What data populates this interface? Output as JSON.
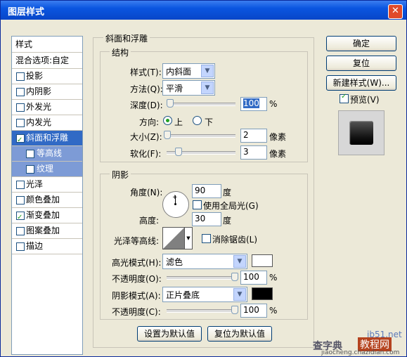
{
  "window": {
    "title": "图层样式",
    "close": "✕"
  },
  "sidebar": {
    "header": "样式",
    "blend": "混合选项:自定",
    "items": [
      {
        "label": "投影",
        "checked": false
      },
      {
        "label": "内阴影",
        "checked": false
      },
      {
        "label": "外发光",
        "checked": false
      },
      {
        "label": "内发光",
        "checked": false
      },
      {
        "label": "斜面和浮雕",
        "checked": true
      },
      {
        "label": "等高线",
        "checked": false
      },
      {
        "label": "纹理",
        "checked": false
      },
      {
        "label": "光泽",
        "checked": false
      },
      {
        "label": "颜色叠加",
        "checked": false
      },
      {
        "label": "渐变叠加",
        "checked": true
      },
      {
        "label": "图案叠加",
        "checked": false
      },
      {
        "label": "描边",
        "checked": false
      }
    ]
  },
  "bevel": {
    "title": "斜面和浮雕",
    "structure": {
      "title": "结构",
      "style_label": "样式(T):",
      "style_value": "内斜面",
      "method_label": "方法(Q):",
      "method_value": "平滑",
      "depth_label": "深度(D):",
      "depth_value": "100",
      "depth_unit": "%",
      "direction_label": "方向:",
      "dir_up": "上",
      "dir_down": "下",
      "size_label": "大小(Z):",
      "size_value": "2",
      "size_unit": "像素",
      "soften_label": "软化(F):",
      "soften_value": "3",
      "soften_unit": "像素"
    },
    "shading": {
      "title": "阴影",
      "angle_label": "角度(N):",
      "angle_value": "90",
      "angle_unit": "度",
      "global_light": "使用全局光(G)",
      "altitude_label": "高度:",
      "altitude_value": "30",
      "altitude_unit": "度",
      "gloss_label": "光泽等高线:",
      "antialias": "消除锯齿(L)",
      "highlight_label": "高光模式(H):",
      "highlight_value": "滤色",
      "highlight_color": "#ffffff",
      "h_opacity_label": "不透明度(O):",
      "h_opacity_value": "100",
      "h_opacity_unit": "%",
      "shadow_label": "阴影模式(A):",
      "shadow_value": "正片叠底",
      "shadow_color": "#000000",
      "s_opacity_label": "不透明度(C):",
      "s_opacity_value": "100",
      "s_opacity_unit": "%"
    },
    "make_default": "设置为默认值",
    "reset_default": "复位为默认值"
  },
  "buttons": {
    "ok": "确定",
    "reset": "复位",
    "new_style": "新建样式(W)...",
    "preview": "预览(V)"
  },
  "watermark": {
    "site": "jb51.net",
    "text1": "查字典",
    "text2": "教程网",
    "url": "jiaocheng.chazidian.com"
  }
}
